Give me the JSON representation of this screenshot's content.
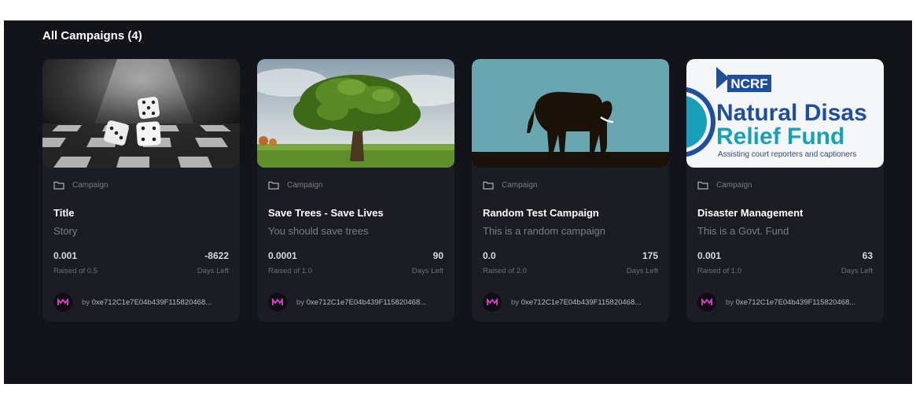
{
  "section": {
    "heading": "All Campaigns (4)"
  },
  "campaigns": [
    {
      "image": "dice-on-chessboard",
      "category": "Campaign",
      "title": "Title",
      "description": "Story",
      "raised": "0.001",
      "raised_of": "Raised of 0.5",
      "days": "-8622",
      "days_label": "Days Left",
      "owner_prefix": "by",
      "owner": "0xe712C1e7E04b439F115820468..."
    },
    {
      "image": "oak-tree-field",
      "category": "Campaign",
      "title": "Save Trees - Save Lives",
      "description": "You should save trees",
      "raised": "0.0001",
      "raised_of": "Raised of 1.0",
      "days": "90",
      "days_label": "Days Left",
      "owner_prefix": "by",
      "owner": "0xe712C1e7E04b439F115820468..."
    },
    {
      "image": "elephant-silhouette",
      "category": "Campaign",
      "title": "Random Test Campaign",
      "description": "This is a random campaign",
      "raised": "0.0",
      "raised_of": "Raised of 2.0",
      "days": "175",
      "days_label": "Days Left",
      "owner_prefix": "by",
      "owner": "0xe712C1e7E04b439F115820468..."
    },
    {
      "image": "ncrf-logo",
      "logo_badge": "NCRF",
      "logo_line1": "Natural Disas",
      "logo_line2": "Relief Fund",
      "logo_tagline": "Assisting court reporters and captioners",
      "category": "Campaign",
      "title": "Disaster Management",
      "description": "This is a Govt. Fund",
      "raised": "0.001",
      "raised_of": "Raised of 1.0",
      "days": "63",
      "days_label": "Days Left",
      "owner_prefix": "by",
      "owner": "0xe712C1e7E04b439F115820468..."
    }
  ],
  "colors": {
    "background": "#13131a",
    "card": "#1c1c24",
    "avatar_accent": "#e040c8",
    "logo_blue": "#1e4e9c",
    "logo_teal": "#18a0b8"
  }
}
